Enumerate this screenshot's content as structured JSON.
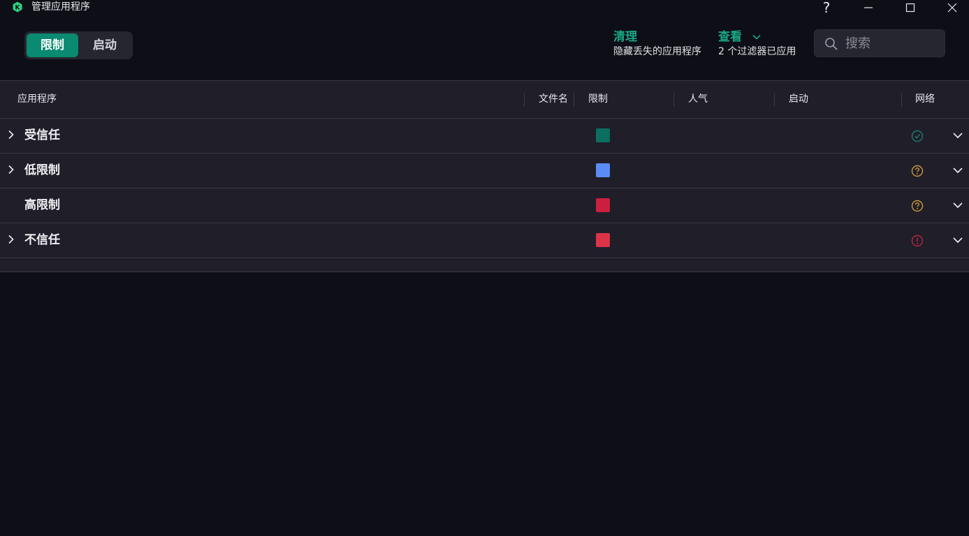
{
  "window": {
    "title": "管理应用程序",
    "help": "?",
    "logo_letter": "K"
  },
  "toggle": {
    "active_label": "限制",
    "inactive_label": "启动"
  },
  "actions": {
    "clean": {
      "title": "清理",
      "subtitle": "隐藏丢失的应用程序"
    },
    "view": {
      "title": "查看",
      "subtitle": "2 个过滤器已应用"
    }
  },
  "search": {
    "placeholder": "搜索",
    "value": ""
  },
  "table": {
    "columns": [
      "应用程序",
      "文件名",
      "限制",
      "人气",
      "启动",
      "网络"
    ],
    "rows": [
      {
        "name": "受信任",
        "expandable": true,
        "color": "#0b6e5f",
        "network": "check-circle-icon",
        "network_color": "#1f7a68"
      },
      {
        "name": "低限制",
        "expandable": true,
        "color": "#5b8cf5",
        "network": "question-circle-icon",
        "network_color": "#c89a3c"
      },
      {
        "name": "高限制",
        "expandable": false,
        "color": "#cc1f3f",
        "network": "question-circle-icon",
        "network_color": "#c89a3c"
      },
      {
        "name": "不信任",
        "expandable": true,
        "color": "#dd3348",
        "network": "warning-circle-icon",
        "network_color": "#b8283a"
      }
    ]
  },
  "colors": {
    "accent": "#19a683",
    "toggle_active": "#0a8a70",
    "background": "#0e0e17",
    "table_bg": "#1f1e29"
  }
}
